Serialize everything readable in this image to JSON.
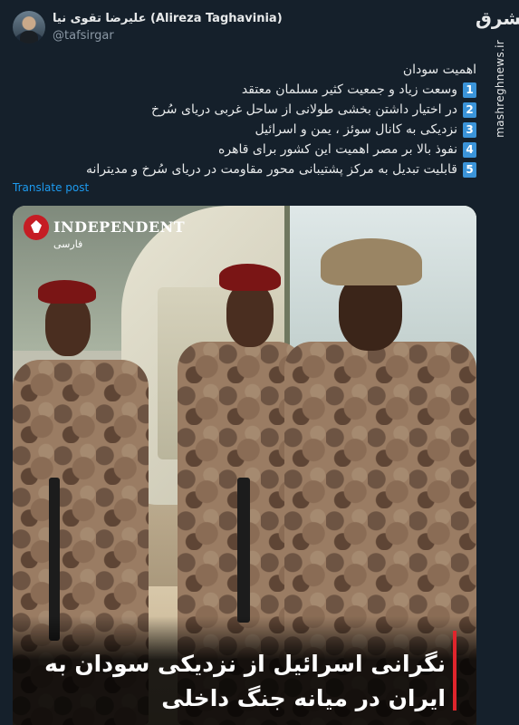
{
  "author": {
    "display_name": "علیرضا تقوی نیا (Alireza Taghavinia)",
    "handle": "@tafsirgar"
  },
  "brand": {
    "logo_text": "مشرق",
    "url": "mashreghnews.ir"
  },
  "tweet": {
    "title": "اهمیت سودان",
    "items": [
      {
        "num": "1",
        "text": "وسعت زیاد و جمعیت کثیر مسلمان معتقد"
      },
      {
        "num": "2",
        "text": "در اختیار داشتن بخشی طولانی از ساحل غربی دریای سُرخ"
      },
      {
        "num": "3",
        "text": "نزدیکی به کانال سوئز ، یمن و اسرائیل"
      },
      {
        "num": "4",
        "text": "نفوذ بالا بر مصر اهمیت این کشور برای قاهره"
      },
      {
        "num": "5",
        "text": "قابلیت تبدیل به مرکز پشتیبانی محور مقاومت در دریای سُرخ و مدیترانه"
      }
    ],
    "translate_label": "Translate post"
  },
  "media": {
    "logo_name": "INDEPENDENT",
    "logo_sub": "فارسی",
    "caption": "نگرانی اسرائیل از نزدیکی سودان به ایران در میانه جنگ داخلی",
    "colors": {
      "accent_red": "#e0252c",
      "link_blue": "#1d9bf0",
      "badge_blue": "#3b94d9"
    }
  }
}
